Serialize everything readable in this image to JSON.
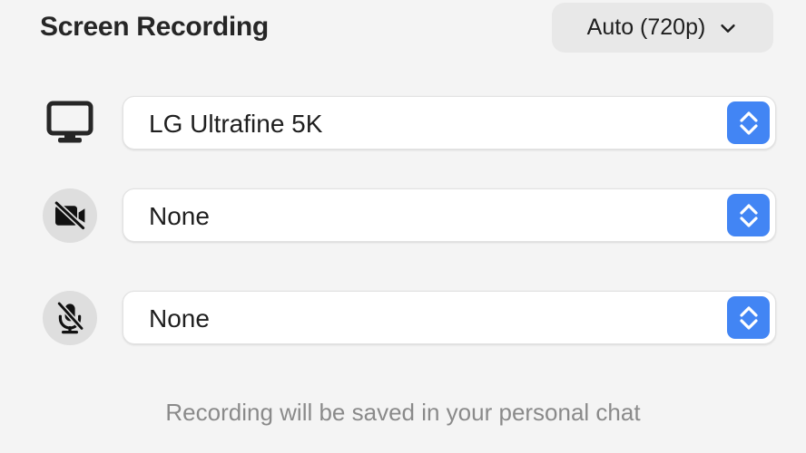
{
  "header": {
    "title": "Screen Recording",
    "quality": {
      "label": "Auto (720p)",
      "icon": "chevron-down-icon"
    }
  },
  "rows": [
    {
      "id": "screen",
      "icon": "monitor-icon",
      "icon_style": "plain",
      "value": "LG Ultrafine 5K",
      "stepper_icon": "chevron-up-down-icon"
    },
    {
      "id": "camera",
      "icon": "video-camera-off-icon",
      "icon_style": "circle",
      "value": "None",
      "stepper_icon": "chevron-up-down-icon"
    },
    {
      "id": "microphone",
      "icon": "microphone-off-icon",
      "icon_style": "circle",
      "value": "None",
      "stepper_icon": "chevron-up-down-icon"
    }
  ],
  "footer": {
    "note": "Recording will be saved in your personal chat"
  },
  "colors": {
    "page_background": "#f4f4f4",
    "pill_background": "#e8e8e8",
    "accent_blue": "#4285f4",
    "icon_circle": "#dedede",
    "title_text": "#262626",
    "value_text": "#1f1f1f",
    "footer_text": "#8a8a8a"
  }
}
